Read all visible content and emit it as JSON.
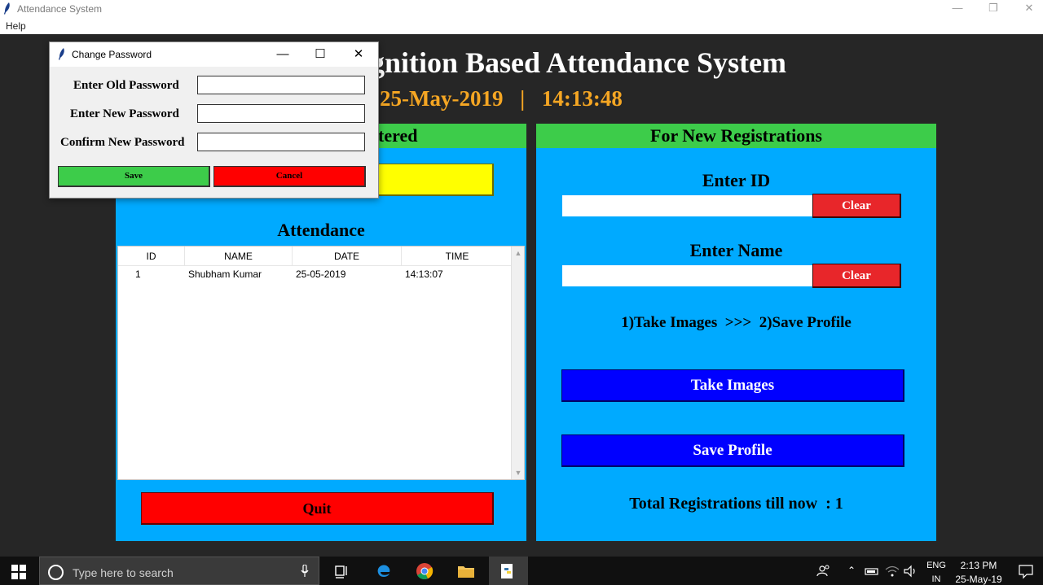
{
  "window": {
    "title": "Attendance System",
    "menu": [
      "Help"
    ],
    "controls": {
      "minimize": "—",
      "maximize": "❐",
      "close": "✕"
    }
  },
  "header": {
    "title_visible": "gnition Based Attendance System",
    "date": "25-May-2019",
    "separator": "|",
    "time": "14:13:48"
  },
  "left_panel": {
    "header_text_visible": "tered",
    "attendance_title": "Attendance",
    "table": {
      "columns": [
        "ID",
        "NAME",
        "DATE",
        "TIME"
      ],
      "rows": [
        {
          "id": "1",
          "name": "Shubham Kumar",
          "date": "25-05-2019",
          "time": "14:13:07"
        }
      ]
    },
    "quit_label": "Quit"
  },
  "right_panel": {
    "header": "For New Registrations",
    "enter_id_label": "Enter ID",
    "enter_id_value": "",
    "clear_id_label": "Clear",
    "enter_name_label": "Enter Name",
    "enter_name_value": "",
    "clear_name_label": "Clear",
    "steps_text": "1)Take Images  >>>  2)Save Profile",
    "take_images_label": "Take Images",
    "save_profile_label": "Save Profile",
    "total_registrations_text": "Total Registrations till now  : 1"
  },
  "dialog": {
    "title": "Change Password",
    "old_password_label": "Enter Old Password",
    "new_password_label": "Enter New Password",
    "confirm_password_label": "Confirm New Password",
    "old_password_value": "",
    "new_password_value": "",
    "confirm_password_value": "",
    "save_label": "Save",
    "cancel_label": "Cancel",
    "controls": {
      "minimize": "—",
      "maximize": "☐",
      "close": "✕"
    }
  },
  "taskbar": {
    "search_placeholder": "Type here to search",
    "language_top": "ENG",
    "language_bottom": "IN",
    "time": "2:13 PM",
    "date": "25-May-19",
    "pinned_icons": [
      "task-view-icon",
      "edge-icon",
      "chrome-icon",
      "file-explorer-icon",
      "python-icon"
    ]
  },
  "colors": {
    "panel_blue": "#00aaff",
    "header_green": "#3dcc4a",
    "quit_red": "#ff0000",
    "action_blue": "#0000ff",
    "datetime_orange": "#f5a623",
    "yellow_button": "#ffff00"
  }
}
